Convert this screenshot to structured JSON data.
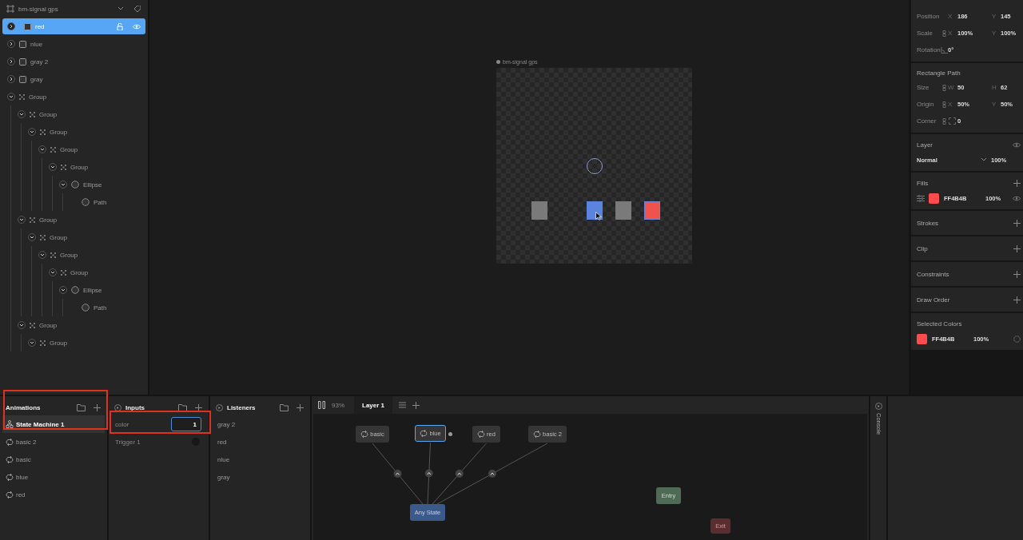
{
  "layers_panel": {
    "artboard": "bm-signal gps",
    "items": [
      {
        "kind": "rectangle",
        "label": "red",
        "expanded": false,
        "selected": true
      },
      {
        "kind": "rectangle",
        "label": "nlue",
        "expanded": false,
        "selected": false
      },
      {
        "kind": "rectangle",
        "label": "gray 2",
        "expanded": false,
        "selected": false
      },
      {
        "kind": "rectangle",
        "label": "gray",
        "expanded": false,
        "selected": false
      },
      {
        "kind": "group",
        "label": "Group",
        "expanded": true,
        "selected": false,
        "children": [
          {
            "kind": "group",
            "label": "Group",
            "expanded": true,
            "selected": false,
            "children": [
              {
                "kind": "group",
                "label": "Group",
                "expanded": true,
                "selected": false,
                "children": [
                  {
                    "kind": "group",
                    "label": "Group",
                    "expanded": true,
                    "selected": false,
                    "children": [
                      {
                        "kind": "group",
                        "label": "Group",
                        "expanded": true,
                        "selected": false,
                        "children": [
                          {
                            "kind": "ellipse",
                            "label": "Ellipse",
                            "expanded": true,
                            "selected": false,
                            "children": [
                              {
                                "kind": "path",
                                "label": "Path",
                                "selected": false
                              }
                            ]
                          }
                        ]
                      }
                    ]
                  }
                ]
              }
            ]
          },
          {
            "kind": "group",
            "label": "Group",
            "expanded": true,
            "selected": false,
            "children": [
              {
                "kind": "group",
                "label": "Group",
                "expanded": true,
                "selected": false,
                "children": [
                  {
                    "kind": "group",
                    "label": "Group",
                    "expanded": true,
                    "selected": false,
                    "children": [
                      {
                        "kind": "group",
                        "label": "Group",
                        "expanded": true,
                        "selected": false,
                        "children": [
                          {
                            "kind": "ellipse",
                            "label": "Ellipse",
                            "expanded": true,
                            "selected": false,
                            "children": [
                              {
                                "kind": "path",
                                "label": "Path",
                                "selected": false
                              }
                            ]
                          }
                        ]
                      }
                    ]
                  }
                ]
              }
            ]
          },
          {
            "kind": "group",
            "label": "Group",
            "expanded": true,
            "selected": false,
            "children": [
              {
                "kind": "group",
                "label": "Group",
                "expanded": true,
                "selected": false
              }
            ]
          }
        ]
      }
    ]
  },
  "canvas": {
    "artboard_label": "bm-signal gps"
  },
  "inspector": {
    "transform": [
      {
        "kind": "position",
        "label": "Position",
        "fields": [
          {
            "axis": "X",
            "value": "186"
          },
          {
            "axis": "Y",
            "value": "145"
          }
        ]
      },
      {
        "kind": "scale",
        "label": "Scale",
        "fields": [
          {
            "axis": "X",
            "value": "100%"
          },
          {
            "axis": "Y",
            "value": "100%"
          }
        ]
      },
      {
        "kind": "rotation",
        "label": "Rotation",
        "fields": [
          {
            "value": "0°"
          }
        ]
      }
    ],
    "rectangle_path": {
      "title": "Rectangle Path",
      "rows": [
        {
          "kind": "size",
          "label": "Size",
          "fields": [
            {
              "axis": "W",
              "value": "50"
            },
            {
              "axis": "H",
              "value": "62"
            }
          ]
        },
        {
          "kind": "origin",
          "label": "Origin",
          "fields": [
            {
              "axis": "X",
              "value": "50%"
            },
            {
              "axis": "Y",
              "value": "50%"
            }
          ]
        },
        {
          "kind": "corner",
          "label": "Corner",
          "fields": [
            {
              "value": "0"
            }
          ]
        }
      ]
    },
    "layer": {
      "title": "Layer",
      "blend_mode": "Normal",
      "opacity": "100%"
    },
    "fills": {
      "title": "Fills",
      "items": [
        {
          "color": "#ff4b4b",
          "hex": "FF4B4B",
          "opacity": "100%"
        }
      ]
    },
    "empty_sections": [
      "Strokes",
      "Clip",
      "Constraints",
      "Draw Order"
    ],
    "selected_colors": {
      "title": "Selected Colors",
      "items": [
        {
          "color": "#ff4b4b",
          "hex": "FF4B4B",
          "opacity": "100%"
        }
      ]
    }
  },
  "animations": {
    "title": "Animations",
    "items": [
      {
        "kind": "state_machine",
        "label": "State Machine 1",
        "selected": true
      },
      {
        "kind": "animation",
        "label": "basic 2",
        "selected": false
      },
      {
        "kind": "animation",
        "label": "basic",
        "selected": false
      },
      {
        "kind": "animation",
        "label": "blue",
        "selected": false
      },
      {
        "kind": "animation",
        "label": "red",
        "selected": false
      }
    ]
  },
  "inputs": {
    "title": "Inputs",
    "items": [
      {
        "kind": "number",
        "name": "color",
        "value": "1"
      },
      {
        "kind": "trigger",
        "name": "Trigger 1"
      }
    ]
  },
  "listeners": {
    "title": "Listeners",
    "items": [
      "gray 2",
      "red",
      "nlue",
      "gray"
    ]
  },
  "state_machine": {
    "zoom": "93%",
    "layers": [
      {
        "label": "Layer 1",
        "selected": true
      }
    ],
    "nodes": [
      {
        "kind": "animation",
        "label": "basic",
        "selected": false
      },
      {
        "kind": "animation",
        "label": "blue",
        "selected": true
      },
      {
        "kind": "animation",
        "label": "red",
        "selected": false
      },
      {
        "kind": "animation",
        "label": "basic 2",
        "selected": false
      },
      {
        "kind": "any",
        "label": "Any State",
        "selected": false
      },
      {
        "kind": "entry",
        "label": "Entry",
        "selected": false
      },
      {
        "kind": "exit",
        "label": "Exit",
        "selected": false
      }
    ]
  },
  "console": {
    "title": "Console"
  }
}
